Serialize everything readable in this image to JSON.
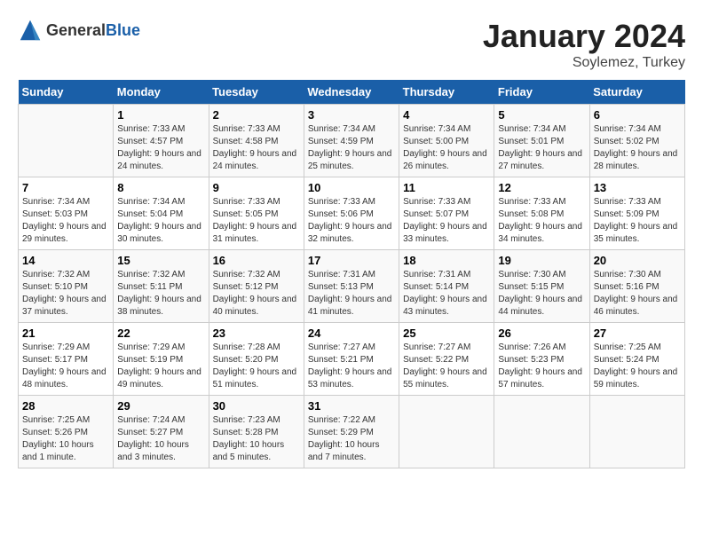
{
  "header": {
    "logo_general": "General",
    "logo_blue": "Blue",
    "month": "January 2024",
    "location": "Soylemez, Turkey"
  },
  "days_of_week": [
    "Sunday",
    "Monday",
    "Tuesday",
    "Wednesday",
    "Thursday",
    "Friday",
    "Saturday"
  ],
  "weeks": [
    [
      {
        "day": "",
        "info": ""
      },
      {
        "day": "1",
        "info": "Sunrise: 7:33 AM\nSunset: 4:57 PM\nDaylight: 9 hours\nand 24 minutes."
      },
      {
        "day": "2",
        "info": "Sunrise: 7:33 AM\nSunset: 4:58 PM\nDaylight: 9 hours\nand 24 minutes."
      },
      {
        "day": "3",
        "info": "Sunrise: 7:34 AM\nSunset: 4:59 PM\nDaylight: 9 hours\nand 25 minutes."
      },
      {
        "day": "4",
        "info": "Sunrise: 7:34 AM\nSunset: 5:00 PM\nDaylight: 9 hours\nand 26 minutes."
      },
      {
        "day": "5",
        "info": "Sunrise: 7:34 AM\nSunset: 5:01 PM\nDaylight: 9 hours\nand 27 minutes."
      },
      {
        "day": "6",
        "info": "Sunrise: 7:34 AM\nSunset: 5:02 PM\nDaylight: 9 hours\nand 28 minutes."
      }
    ],
    [
      {
        "day": "7",
        "info": "Sunrise: 7:34 AM\nSunset: 5:03 PM\nDaylight: 9 hours\nand 29 minutes."
      },
      {
        "day": "8",
        "info": "Sunrise: 7:34 AM\nSunset: 5:04 PM\nDaylight: 9 hours\nand 30 minutes."
      },
      {
        "day": "9",
        "info": "Sunrise: 7:33 AM\nSunset: 5:05 PM\nDaylight: 9 hours\nand 31 minutes."
      },
      {
        "day": "10",
        "info": "Sunrise: 7:33 AM\nSunset: 5:06 PM\nDaylight: 9 hours\nand 32 minutes."
      },
      {
        "day": "11",
        "info": "Sunrise: 7:33 AM\nSunset: 5:07 PM\nDaylight: 9 hours\nand 33 minutes."
      },
      {
        "day": "12",
        "info": "Sunrise: 7:33 AM\nSunset: 5:08 PM\nDaylight: 9 hours\nand 34 minutes."
      },
      {
        "day": "13",
        "info": "Sunrise: 7:33 AM\nSunset: 5:09 PM\nDaylight: 9 hours\nand 35 minutes."
      }
    ],
    [
      {
        "day": "14",
        "info": "Sunrise: 7:32 AM\nSunset: 5:10 PM\nDaylight: 9 hours\nand 37 minutes."
      },
      {
        "day": "15",
        "info": "Sunrise: 7:32 AM\nSunset: 5:11 PM\nDaylight: 9 hours\nand 38 minutes."
      },
      {
        "day": "16",
        "info": "Sunrise: 7:32 AM\nSunset: 5:12 PM\nDaylight: 9 hours\nand 40 minutes."
      },
      {
        "day": "17",
        "info": "Sunrise: 7:31 AM\nSunset: 5:13 PM\nDaylight: 9 hours\nand 41 minutes."
      },
      {
        "day": "18",
        "info": "Sunrise: 7:31 AM\nSunset: 5:14 PM\nDaylight: 9 hours\nand 43 minutes."
      },
      {
        "day": "19",
        "info": "Sunrise: 7:30 AM\nSunset: 5:15 PM\nDaylight: 9 hours\nand 44 minutes."
      },
      {
        "day": "20",
        "info": "Sunrise: 7:30 AM\nSunset: 5:16 PM\nDaylight: 9 hours\nand 46 minutes."
      }
    ],
    [
      {
        "day": "21",
        "info": "Sunrise: 7:29 AM\nSunset: 5:17 PM\nDaylight: 9 hours\nand 48 minutes."
      },
      {
        "day": "22",
        "info": "Sunrise: 7:29 AM\nSunset: 5:19 PM\nDaylight: 9 hours\nand 49 minutes."
      },
      {
        "day": "23",
        "info": "Sunrise: 7:28 AM\nSunset: 5:20 PM\nDaylight: 9 hours\nand 51 minutes."
      },
      {
        "day": "24",
        "info": "Sunrise: 7:27 AM\nSunset: 5:21 PM\nDaylight: 9 hours\nand 53 minutes."
      },
      {
        "day": "25",
        "info": "Sunrise: 7:27 AM\nSunset: 5:22 PM\nDaylight: 9 hours\nand 55 minutes."
      },
      {
        "day": "26",
        "info": "Sunrise: 7:26 AM\nSunset: 5:23 PM\nDaylight: 9 hours\nand 57 minutes."
      },
      {
        "day": "27",
        "info": "Sunrise: 7:25 AM\nSunset: 5:24 PM\nDaylight: 9 hours\nand 59 minutes."
      }
    ],
    [
      {
        "day": "28",
        "info": "Sunrise: 7:25 AM\nSunset: 5:26 PM\nDaylight: 10 hours\nand 1 minute."
      },
      {
        "day": "29",
        "info": "Sunrise: 7:24 AM\nSunset: 5:27 PM\nDaylight: 10 hours\nand 3 minutes."
      },
      {
        "day": "30",
        "info": "Sunrise: 7:23 AM\nSunset: 5:28 PM\nDaylight: 10 hours\nand 5 minutes."
      },
      {
        "day": "31",
        "info": "Sunrise: 7:22 AM\nSunset: 5:29 PM\nDaylight: 10 hours\nand 7 minutes."
      },
      {
        "day": "",
        "info": ""
      },
      {
        "day": "",
        "info": ""
      },
      {
        "day": "",
        "info": ""
      }
    ]
  ]
}
